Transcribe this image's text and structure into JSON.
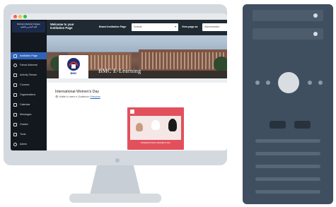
{
  "colors": {
    "sidebar_bg": "#12181e",
    "sidebar_active": "#2f63b8",
    "topbar_bg": "#1f2a33",
    "link": "#2f63b8",
    "card_accent": "#e2505c",
    "tower_body": "#3f4f60",
    "monitor_bezel": "#d3d9df"
  },
  "sidebar": {
    "logo_text": "Bahrain Medical College",
    "logo_sub": "كلية البحرين الطبية",
    "items": [
      {
        "label": "Institution Page",
        "icon": "institution-icon"
      },
      {
        "label": "Fahad Alahmari",
        "icon": "user-icon"
      },
      {
        "label": "Activity Stream",
        "icon": "activity-icon"
      },
      {
        "label": "Courses",
        "icon": "courses-icon"
      },
      {
        "label": "Organizations",
        "icon": "organizations-icon"
      },
      {
        "label": "Calendar",
        "icon": "calendar-icon"
      },
      {
        "label": "Messages",
        "icon": "messages-icon"
      },
      {
        "label": "Grades",
        "icon": "grades-icon"
      },
      {
        "label": "Tools",
        "icon": "tools-icon"
      },
      {
        "label": "Admin",
        "icon": "admin-icon"
      }
    ]
  },
  "topbar": {
    "title": "Welcome to your Institution Page",
    "brand_label": "Brand Institution Page",
    "brand_value": "Default",
    "view_label": "View page as",
    "view_value": "Administrator"
  },
  "banner": {
    "title": "BMC E-Learning",
    "logo_text": "BMC"
  },
  "post": {
    "title": "International Women's Day",
    "visibility": "Visible to users",
    "audience_label": "Audience:",
    "audience_value": "Everyone",
    "card_caption": "INTERNATIONAL WOMEN'S DAY"
  }
}
